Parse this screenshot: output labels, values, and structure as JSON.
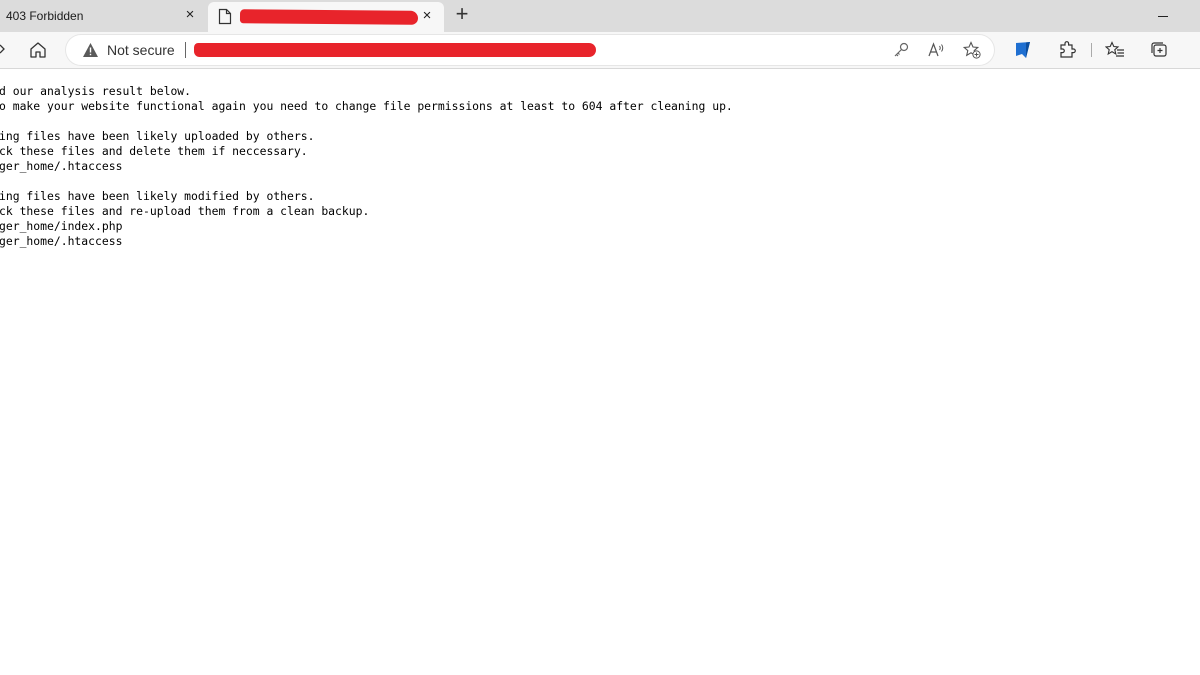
{
  "tabs": [
    {
      "title": "403 Forbidden",
      "close_label": "×"
    },
    {
      "close_label": "×"
    }
  ],
  "newtab_label": "+",
  "address": {
    "security_label": "Not secure"
  },
  "icons": {
    "tab_page": "page-icon",
    "home": "home-icon",
    "warning": "warning-icon",
    "key": "key-icon",
    "read_aloud": "read-aloud-icon",
    "add_favorite": "add-favorite-icon",
    "bookmark": "bookmark-icon",
    "extensions": "extensions-icon",
    "favorites": "favorites-icon",
    "collections": "collections-icon"
  },
  "colors": {
    "redaction": "#e8242b",
    "accent_blue": "#1f6fd1"
  },
  "content": {
    "lines": [
      "d our analysis result below.",
      "o make your website functional again you need to change file permissions at least to 604 after cleaning up.",
      "",
      "ing files have been likely uploaded by others.",
      "ck these files and delete them if neccessary.",
      "ger_home/.htaccess",
      "",
      "ing files have been likely modified by others.",
      "ck these files and re-upload them from a clean backup.",
      "ger_home/index.php",
      "ger_home/.htaccess"
    ]
  }
}
